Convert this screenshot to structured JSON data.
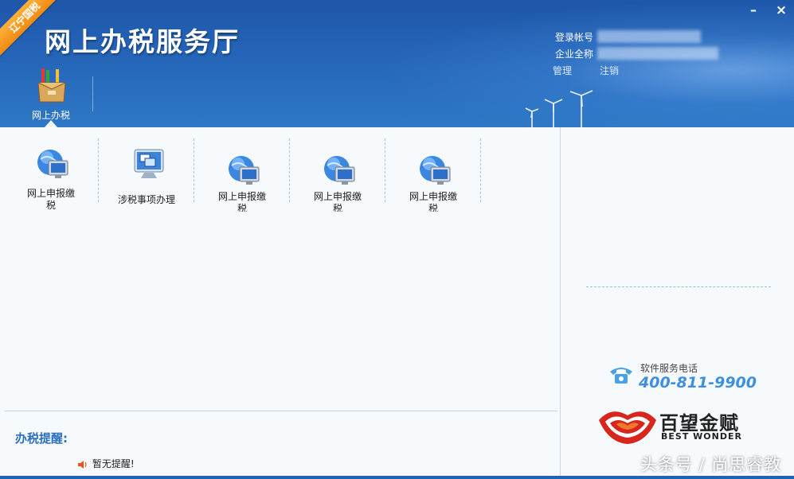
{
  "header": {
    "ribbon": "辽宁国税",
    "title": "网上办税服务厅",
    "account_label": "登录帐号",
    "company_label": "企业全称",
    "manage_link": "管理",
    "logout_link": "注销",
    "window_min": "–",
    "window_close": "×"
  },
  "nav": {
    "tabs": [
      {
        "label": "网上办税",
        "icon": "package-icon",
        "active": true
      }
    ]
  },
  "functions": [
    {
      "label": "网上申报缴税",
      "icon": "globe-monitor-icon"
    },
    {
      "label": "涉税事项办理",
      "icon": "monitor-windows-icon"
    },
    {
      "label": "网上申报缴税",
      "icon": "globe-monitor-icon"
    },
    {
      "label": "网上申报缴税",
      "icon": "globe-monitor-icon"
    },
    {
      "label": "网上申报缴税",
      "icon": "globe-monitor-icon"
    }
  ],
  "reminder": {
    "title": "办税提醒:",
    "items": [
      "暂无提醒!"
    ]
  },
  "support": {
    "phone_label": "软件服务电话",
    "phone_number": "400-811-9900",
    "brand_name": "百望金赋",
    "brand_en": "BEST WONDER"
  },
  "watermark": "头条号 / 尚思睿教",
  "colors": {
    "header_blue": "#2565b8",
    "ribbon_orange": "#f59a1e",
    "reminder_blue": "#2b6fc0",
    "phone_blue": "#3d8fe0",
    "brand_red": "#d7261e"
  }
}
